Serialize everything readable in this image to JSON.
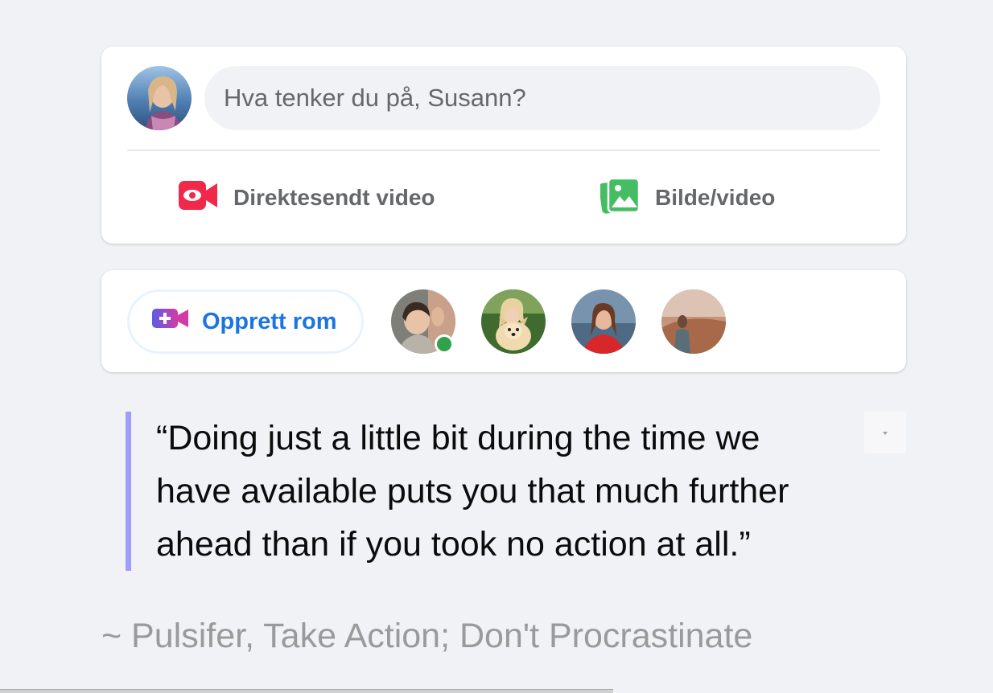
{
  "composer": {
    "prompt": "Hva tenker du på, Susann?",
    "live_label": "Direktesendt video",
    "photo_label": "Bilde/video",
    "live_color": "#f02849",
    "photo_color": "#45bd62"
  },
  "rooms": {
    "create_label": "Opprett rom",
    "contacts_count_visible": 4,
    "online_indicator_color": "#31a24c"
  },
  "quote": {
    "lines": [
      "“Doing just a little bit during the time we",
      "have available puts you that much further",
      "ahead than if you took no action at all.”"
    ],
    "attribution": "~ Pulsifer, Take Action; Don't Procrastinate",
    "accent_color": "#9e9ef7"
  }
}
